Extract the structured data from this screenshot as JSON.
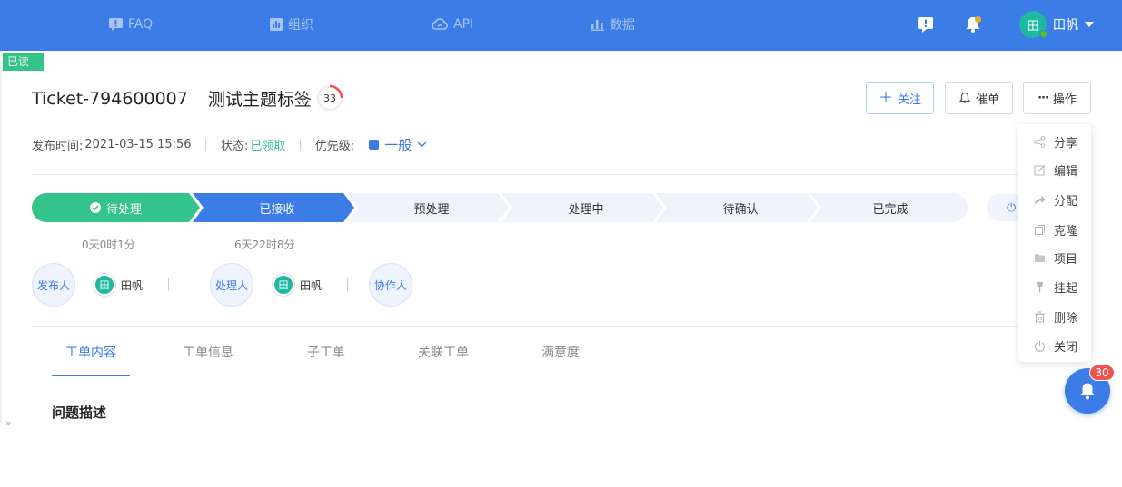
{
  "nav": {
    "items": [
      {
        "label": "FAQ",
        "icon": "faq-icon"
      },
      {
        "label": "组织",
        "icon": "org-icon"
      },
      {
        "label": "API",
        "icon": "api-icon"
      },
      {
        "label": "数据",
        "icon": "chart-icon"
      }
    ],
    "user": {
      "avatar_text": "田",
      "name": "田帆"
    }
  },
  "read_badge": "已读",
  "ticket": {
    "id": "Ticket-794600007",
    "subject": "测试主题标签",
    "score": "33",
    "meta": {
      "publish_label": "发布时间:",
      "publish_time": "2021-03-15 15:56",
      "status_label": "状态:",
      "status_value": "已领取",
      "priority_label": "优先级:",
      "priority_value": "一般"
    }
  },
  "actions": {
    "follow": "关注",
    "urge": "催单",
    "ops": "操作"
  },
  "steps": [
    {
      "label": "待处理",
      "time": "0天0时1分",
      "state": "done"
    },
    {
      "label": "已接收",
      "time": "6天22时8分",
      "state": "current"
    },
    {
      "label": "预处理",
      "time": "",
      "state": "todo"
    },
    {
      "label": "处理中",
      "time": "",
      "state": "todo"
    },
    {
      "label": "待确认",
      "time": "",
      "state": "todo"
    },
    {
      "label": "已完成",
      "time": "",
      "state": "todo"
    }
  ],
  "roles": {
    "publisher_label": "发布人",
    "publisher_avatar": "田",
    "publisher_name": "田帆",
    "handler_label": "处理人",
    "handler_avatar": "田",
    "handler_name": "田帆",
    "collaborator_label": "协作人"
  },
  "tabs": [
    "工单内容",
    "工单信息",
    "子工单",
    "关联工单",
    "满意度"
  ],
  "section_title": "问题描述",
  "menu": [
    {
      "label": "分享",
      "icon": "share-icon"
    },
    {
      "label": "编辑",
      "icon": "edit-icon"
    },
    {
      "label": "分配",
      "icon": "assign-icon"
    },
    {
      "label": "克隆",
      "icon": "clone-icon"
    },
    {
      "label": "项目",
      "icon": "folder-icon"
    },
    {
      "label": "挂起",
      "icon": "pin-icon"
    },
    {
      "label": "删除",
      "icon": "trash-icon"
    },
    {
      "label": "关闭",
      "icon": "power-icon"
    }
  ],
  "notifications_count": "30",
  "colors": {
    "primary": "#3b7ce6",
    "success": "#32c48a",
    "badge": "#ef5350",
    "teal": "#1fb8a0"
  }
}
